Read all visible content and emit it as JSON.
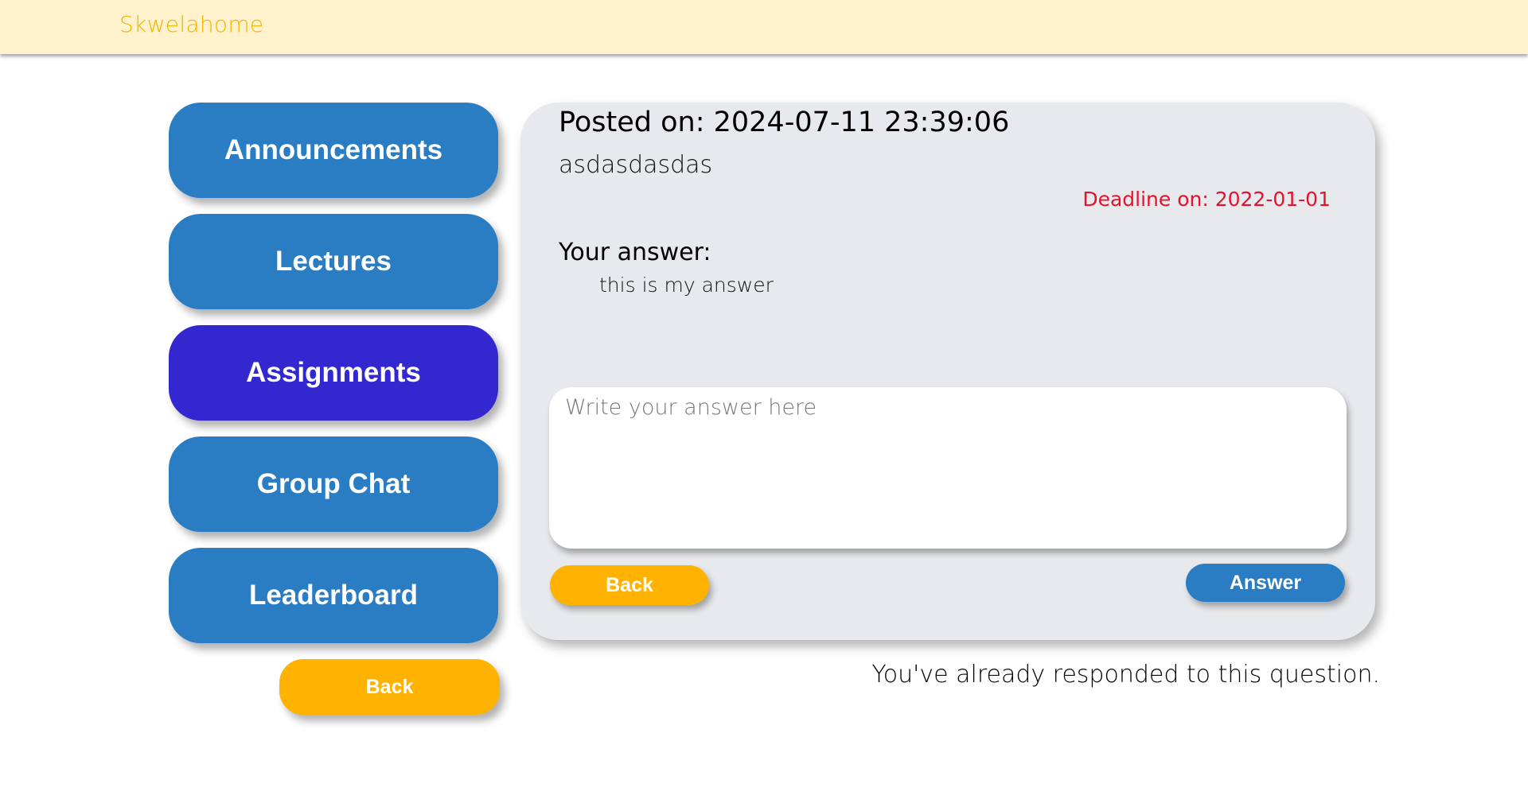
{
  "header": {
    "brand": "Skwelahome",
    "brand_color": "#f5b400",
    "background": "#fff2cc"
  },
  "sidebar": {
    "items": [
      {
        "label": "Announcements",
        "active": false
      },
      {
        "label": "Lectures",
        "active": false
      },
      {
        "label": "Assignments",
        "active": true
      },
      {
        "label": "Group Chat",
        "active": false
      },
      {
        "label": "Leaderboard",
        "active": false
      }
    ],
    "back_label": "Back",
    "item_color": "#2a7dc3",
    "active_color": "#3328d0",
    "back_color": "#ffb300"
  },
  "assignment": {
    "posted_on": "Posted on: 2024-07-11 23:39:06",
    "question": "asdasdasdas",
    "deadline": "Deadline on: 2022-01-01",
    "your_answer_label": "Your answer:",
    "your_answer_text": "this is my answer",
    "answer_placeholder": "Write your answer here",
    "back_label": "Back",
    "answer_label": "Answer",
    "deadline_color": "#e8112d"
  },
  "status_message": "You've already responded to this question."
}
